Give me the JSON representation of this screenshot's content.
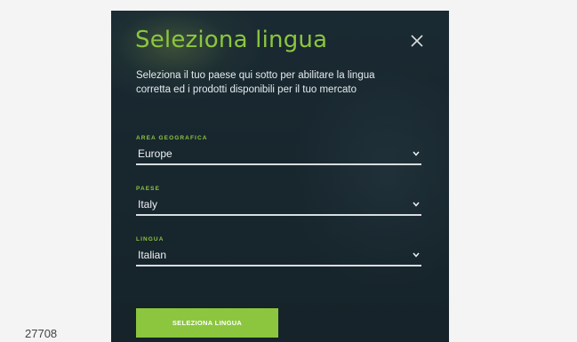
{
  "page": {
    "id_number": "27708"
  },
  "modal": {
    "title": "Seleziona lingua",
    "close_icon": "close-icon",
    "intro": "Seleziona il tuo paese qui sotto per abilitare la lingua corretta ed i prodotti disponibili per il tuo mercato",
    "fields": [
      {
        "label": "AREA GEOGRAFICA",
        "value": "Europe"
      },
      {
        "label": "PAESE",
        "value": "Italy"
      },
      {
        "label": "LINGUA",
        "value": "Italian"
      }
    ],
    "submit_label": "SELEZIONA LINGUA"
  },
  "colors": {
    "accent": "#8cc63f",
    "modal_background": "#1b2b33",
    "page_background": "#f4f4f4"
  }
}
